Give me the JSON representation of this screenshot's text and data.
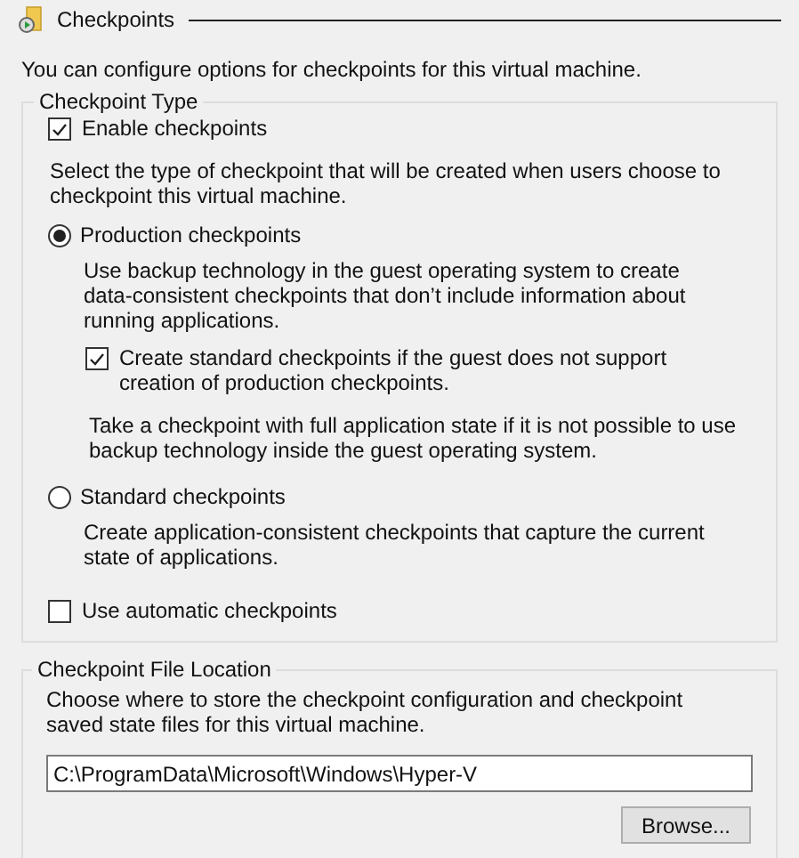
{
  "section": {
    "title": "Checkpoints"
  },
  "intro": "You can configure options for checkpoints for this virtual machine.",
  "checkpoint_type": {
    "legend": "Checkpoint Type",
    "enable": {
      "label": "Enable checkpoints",
      "checked": true
    },
    "instruction": "Select the type of checkpoint that will be created when users choose to checkpoint this virtual machine.",
    "options": [
      {
        "label": "Production checkpoints",
        "selected": true,
        "description": "Use backup technology in the guest operating system to create data-consistent checkpoints that don’t include information about running applications.",
        "fallback": {
          "label": "Create standard checkpoints if the guest does not support creation of production checkpoints.",
          "checked": true
        },
        "note": "Take a checkpoint with full application state if it is not possible to use backup technology inside the guest operating system."
      },
      {
        "label": "Standard checkpoints",
        "selected": false,
        "description": "Create application-consistent checkpoints that capture the current state of applications."
      }
    ],
    "automatic": {
      "label": "Use automatic checkpoints",
      "checked": false
    }
  },
  "file_location": {
    "legend": "Checkpoint File Location",
    "description": "Choose where to store the checkpoint configuration and checkpoint saved state files for this virtual machine.",
    "path": "C:\\ProgramData\\Microsoft\\Windows\\Hyper-V",
    "browse_button": "Browse..."
  }
}
